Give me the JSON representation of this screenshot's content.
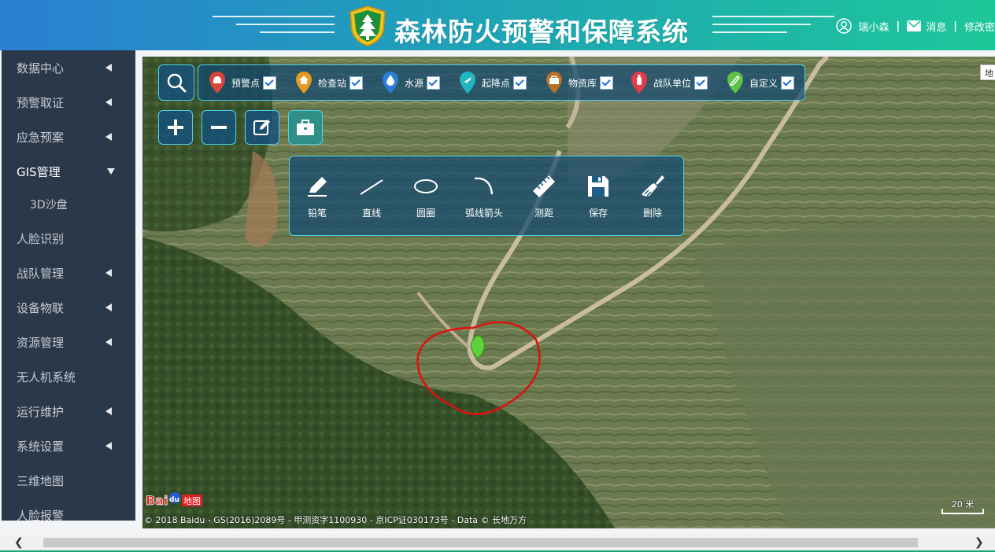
{
  "header": {
    "title": "森林防火预警和保障系统",
    "user": {
      "name": "瑞小森",
      "messages": "消息",
      "change_password": "修改密"
    },
    "colors": {
      "start": "#2a7fd2",
      "end": "#1ec79a"
    },
    "logo_icon": "forest-shield-logo"
  },
  "sidebar": {
    "items": [
      {
        "label": "数据中心",
        "arrow": true
      },
      {
        "label": "预警取证",
        "arrow": true
      },
      {
        "label": "应急预案",
        "arrow": true
      },
      {
        "label": "GIS管理",
        "arrow": true,
        "open": true
      },
      {
        "label": "3D沙盘",
        "sub": true
      },
      {
        "label": "人脸识别",
        "arrow": false
      },
      {
        "label": "战队管理",
        "arrow": true
      },
      {
        "label": "设备物联",
        "arrow": true
      },
      {
        "label": "资源管理",
        "arrow": true
      },
      {
        "label": "无人机系统",
        "arrow": false
      },
      {
        "label": "运行维护",
        "arrow": true
      },
      {
        "label": "系统设置",
        "arrow": true
      },
      {
        "label": "三维地图",
        "arrow": false
      },
      {
        "label": "人脸报警",
        "arrow": false
      }
    ]
  },
  "map": {
    "layers": [
      {
        "label": "预警点",
        "icon": "alarm-pin-icon",
        "color": "#d9443a",
        "checked": true
      },
      {
        "label": "检查站",
        "icon": "house-pin-icon",
        "color": "#e79a1e",
        "checked": true
      },
      {
        "label": "水源",
        "icon": "water-drop-pin-icon",
        "color": "#2a7fd8",
        "checked": true
      },
      {
        "label": "起降点",
        "icon": "plane-pin-icon",
        "color": "#1fb6c2",
        "checked": true
      },
      {
        "label": "物资库",
        "icon": "briefcase-pin-icon",
        "color": "#b7702a",
        "checked": true
      },
      {
        "label": "战队单位",
        "icon": "extinguisher-pin-icon",
        "color": "#e33b4a",
        "checked": true
      },
      {
        "label": "自定义",
        "icon": "pencil-pin-icon",
        "color": "#5fc24a",
        "checked": true
      }
    ],
    "tools": [
      {
        "label": "铅笔",
        "icon": "pencil-icon"
      },
      {
        "label": "直线",
        "icon": "line-icon"
      },
      {
        "label": "圆圈",
        "icon": "ellipse-icon"
      },
      {
        "label": "弧线箭头",
        "icon": "arc-arrow-icon"
      },
      {
        "label": "测距",
        "icon": "ruler-icon"
      },
      {
        "label": "保存",
        "icon": "save-icon"
      },
      {
        "label": "删除",
        "icon": "brush-icon"
      }
    ],
    "copyright": "© 2018 Baidu - GS(2016)2089号 - 甲测资字1100930 - 京ICP证030173号 - Data © 长地万方",
    "scale": "20 米",
    "map_type": "地",
    "baidu_logo_text": "Baidu地图"
  }
}
